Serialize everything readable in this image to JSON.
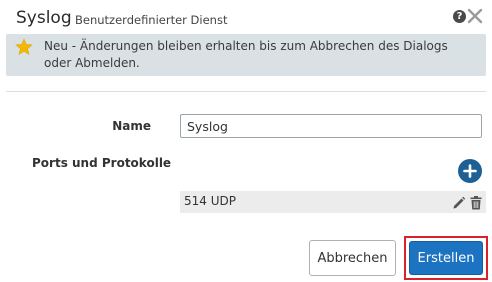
{
  "dialog": {
    "title": "Syslog",
    "subtitle": "Benutzerdefinierter Dienst",
    "help_icon": "question-circle-icon",
    "close_icon": "close-icon"
  },
  "banner": {
    "icon": "star-icon",
    "icon_color": "#f5b800",
    "background": "#d9e1e5",
    "text": "Neu - Änderungen bleiben erhalten bis zum Abbrechen des Dialogs oder Abmelden."
  },
  "form": {
    "name_label": "Name",
    "name_value": "Syslog",
    "ports_label": "Ports und Protokolle",
    "add_icon": "plus-circle-icon",
    "ports": [
      {
        "value": "514 UDP",
        "edit_icon": "pencil-icon",
        "delete_icon": "trash-icon"
      }
    ]
  },
  "buttons": {
    "cancel_label": "Abbrechen",
    "create_label": "Erstellen",
    "primary_color": "#1c73c1",
    "highlight_color": "#d8232a"
  }
}
